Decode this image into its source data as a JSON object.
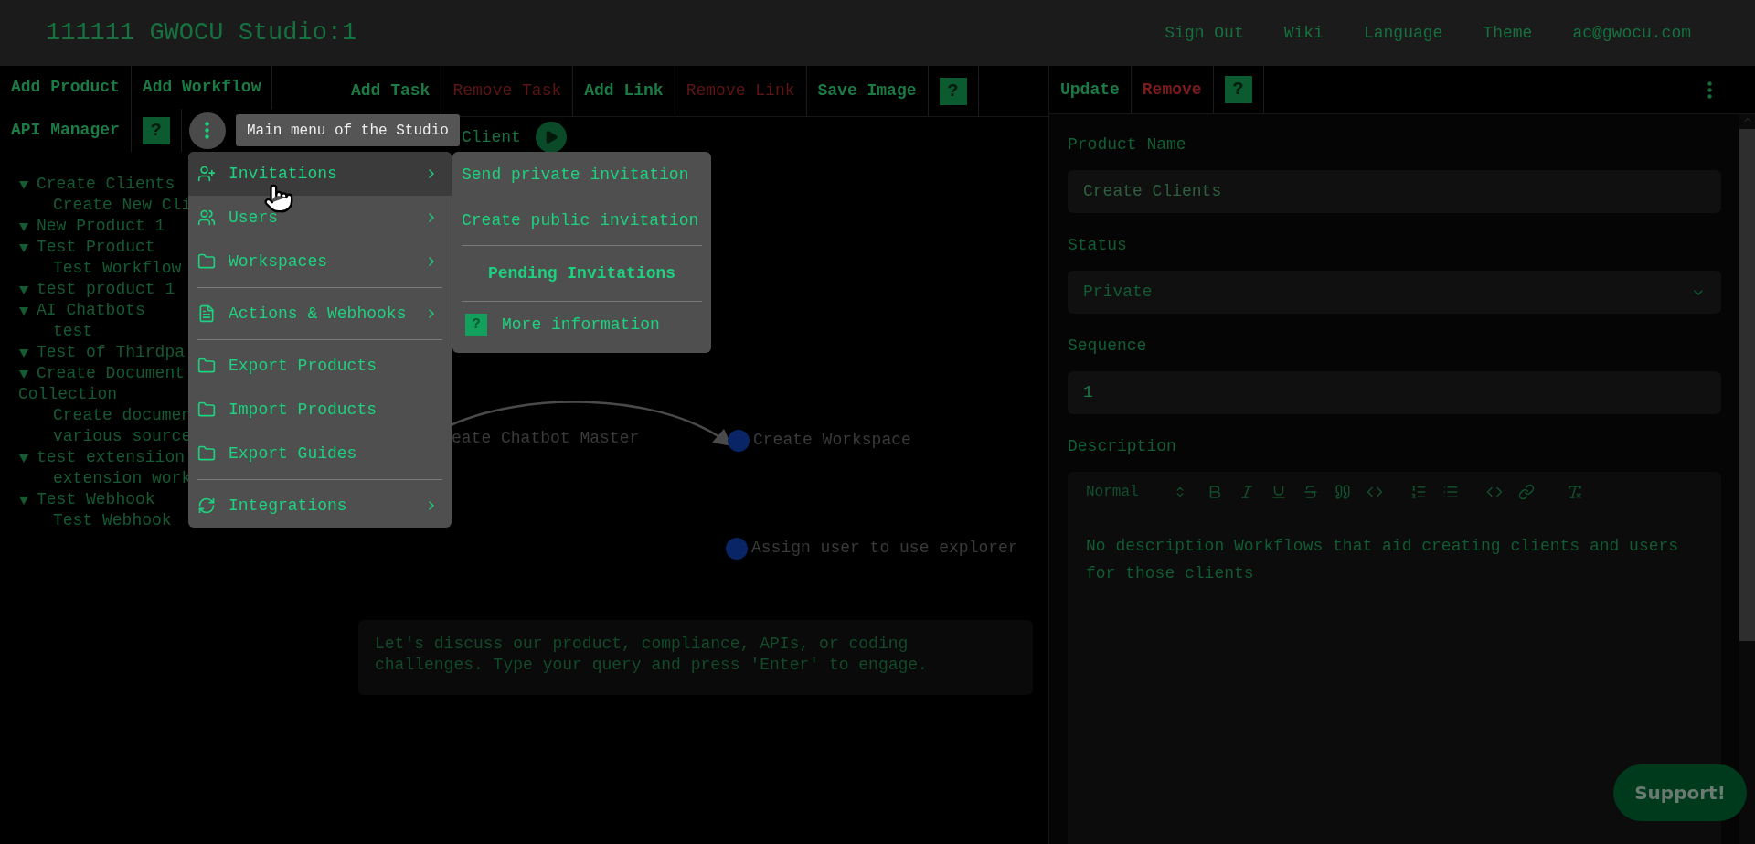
{
  "header": {
    "title": "111111 GWOCU Studio:1",
    "links": [
      "Sign Out",
      "Wiki",
      "Language",
      "Theme",
      "ac@gwocu.com"
    ]
  },
  "left_toolbar": {
    "rows": [
      [
        {
          "label": "Add Product",
          "kind": "action"
        },
        {
          "label": "Add Workflow",
          "kind": "action"
        }
      ],
      [
        {
          "label": "API Manager",
          "kind": "action"
        },
        {
          "label": "?",
          "kind": "help"
        },
        {
          "kind": "menu"
        }
      ]
    ],
    "tooltip": "Main menu of the Studio"
  },
  "tree": [
    {
      "label": "Create Clients",
      "expanded": true,
      "children": [
        {
          "label": "Create New Cli"
        }
      ]
    },
    {
      "label": "New Product 1",
      "expanded": true
    },
    {
      "label": "Test Product",
      "expanded": true,
      "children": [
        {
          "label": "Test Workflow"
        }
      ]
    },
    {
      "label": "test product 1",
      "expanded": true
    },
    {
      "label": "AI Chatbots",
      "expanded": true,
      "children": [
        {
          "label": "test"
        }
      ]
    },
    {
      "label": "Test of Thirdpa",
      "expanded": true
    },
    {
      "label": "Create Document",
      "label_2": "Collection",
      "expanded": true,
      "children": [
        {
          "label": "Create documen",
          "label_2": "various source"
        }
      ]
    },
    {
      "label": "test extensiion",
      "expanded": true,
      "children": [
        {
          "label": "extension work"
        }
      ]
    },
    {
      "label": "Test Webhook",
      "expanded": true,
      "children": [
        {
          "label": "Test Webhook"
        }
      ]
    }
  ],
  "main_menu": {
    "items": [
      {
        "label": "Invitations",
        "submenu": true,
        "selected": true,
        "divider_before": false
      },
      {
        "label": "Users",
        "submenu": true,
        "selected": false,
        "divider_before": false
      },
      {
        "label": "Workspaces",
        "submenu": true,
        "selected": false,
        "divider_before": false
      },
      {
        "label": "Actions & Webhooks",
        "submenu": true,
        "selected": false,
        "divider_before": true
      },
      {
        "label": "Export Products",
        "submenu": false,
        "selected": false,
        "divider_before": true
      },
      {
        "label": "Import Products",
        "submenu": false,
        "selected": false,
        "divider_before": false
      },
      {
        "label": "Export Guides",
        "submenu": false,
        "selected": false,
        "divider_before": false
      },
      {
        "label": "Integrations",
        "submenu": true,
        "selected": false,
        "divider_before": true
      }
    ]
  },
  "submenu": [
    {
      "label": "Send private invitation",
      "kind": "link"
    },
    {
      "label": "Create public invitation",
      "kind": "link"
    },
    {
      "label": "Pending Invitations",
      "kind": "heading"
    },
    {
      "label": "More information",
      "kind": "help",
      "help": "?"
    }
  ],
  "middle_toolbar": [
    {
      "label": "Add Task",
      "kind": "action"
    },
    {
      "label": "Remove Task",
      "kind": "danger"
    },
    {
      "label": "Add Link",
      "kind": "action"
    },
    {
      "label": "Remove Link",
      "kind": "danger"
    },
    {
      "label": "Save Image",
      "kind": "action"
    },
    {
      "label": "?",
      "kind": "help"
    }
  ],
  "canvas": {
    "title": "Client",
    "nodes": [
      {
        "label": "eate Chatbot Master",
        "dot": false
      },
      {
        "label": "Create Workspace",
        "dot": true
      },
      {
        "label": "Assign user to use explorer",
        "dot": true
      }
    ],
    "chat_prompt": "Let's discuss our product, compliance, APIs, or coding challenges. Type your query and press 'Enter' to engage."
  },
  "right_toolbar": [
    {
      "label": "Update",
      "kind": "action"
    },
    {
      "label": "Remove",
      "kind": "danger_bold"
    },
    {
      "label": "?",
      "kind": "help"
    },
    {
      "kind": "menu"
    }
  ],
  "form": [
    {
      "label": "Product Name",
      "kind": "text",
      "value": "Create Clients",
      "disabled": true
    },
    {
      "label": "Status",
      "kind": "select",
      "value": "Private",
      "disabled": false
    },
    {
      "label": "Sequence",
      "kind": "text",
      "value": "1",
      "disabled": false
    },
    {
      "label": "Description",
      "kind": "editor",
      "format": "Normal",
      "value": "No description Workflows that aid creating clients and users for those clients"
    }
  ],
  "support_button": "Support!"
}
